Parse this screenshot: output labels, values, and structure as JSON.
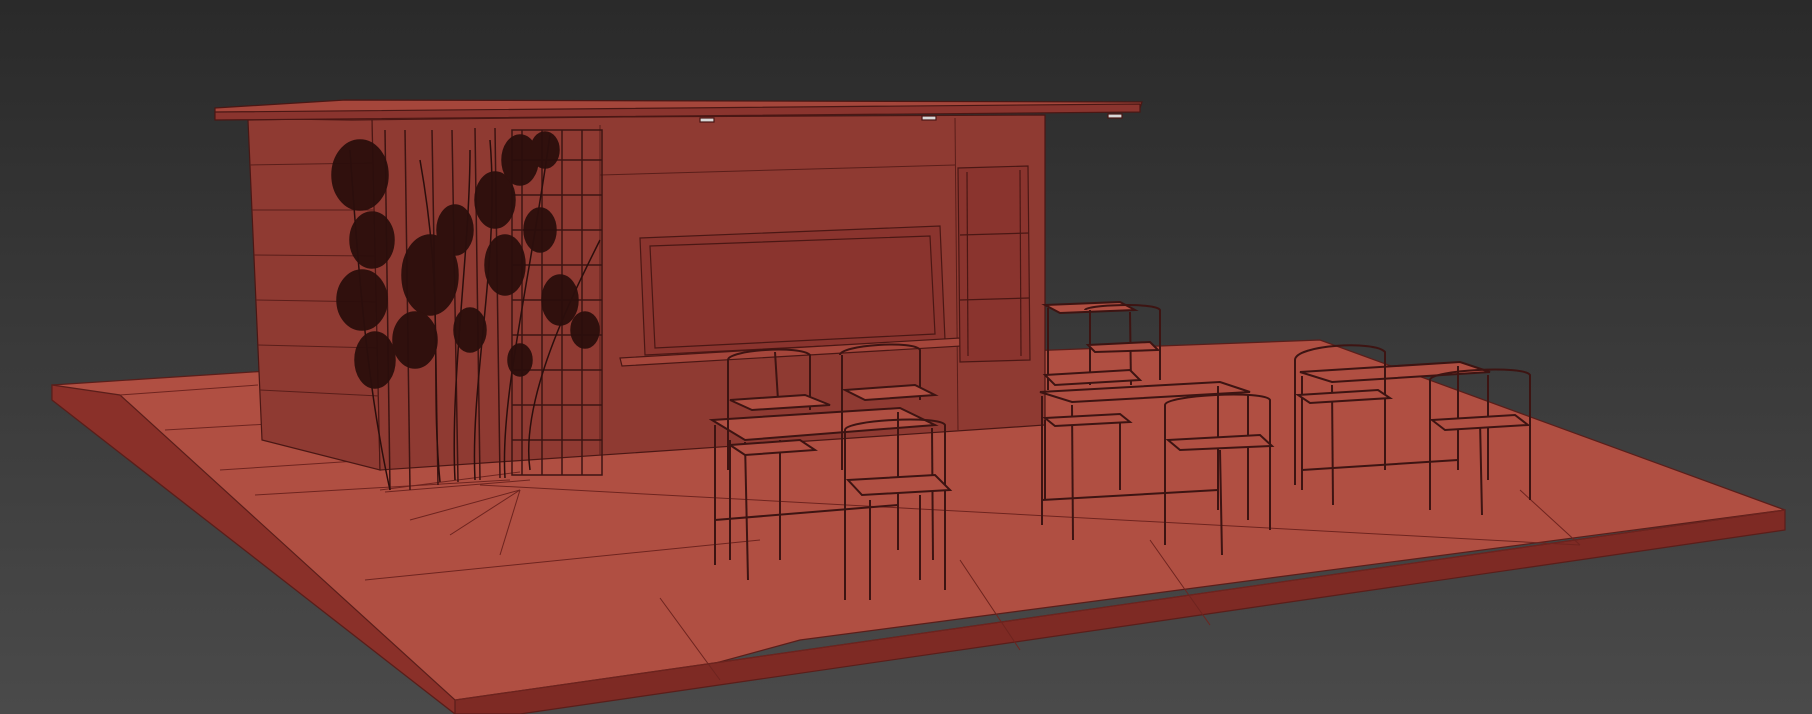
{
  "viewport": {
    "background_top": "#2a2a2a",
    "background_bottom": "#4a4a4a",
    "wire_color": "#3d1412",
    "ground_top_color": "#b04f42",
    "ground_edge_color": "#7e2a24",
    "wall_color": "#8f3a32",
    "roof_color": "#a5463b",
    "panel_color": "#8a342e",
    "plant_color": "#2b0e0c"
  },
  "scene": {
    "objects": [
      {
        "name": "ground-slab",
        "kind": "mesh"
      },
      {
        "name": "kiosk-building",
        "kind": "mesh"
      },
      {
        "name": "roof-canopy",
        "kind": "mesh"
      },
      {
        "name": "climbing-plants",
        "kind": "mesh"
      },
      {
        "name": "trellis",
        "kind": "mesh"
      },
      {
        "name": "table-set-1",
        "kind": "group"
      },
      {
        "name": "table-set-2",
        "kind": "group"
      },
      {
        "name": "table-set-3",
        "kind": "group"
      },
      {
        "name": "table-set-4",
        "kind": "group"
      }
    ]
  }
}
